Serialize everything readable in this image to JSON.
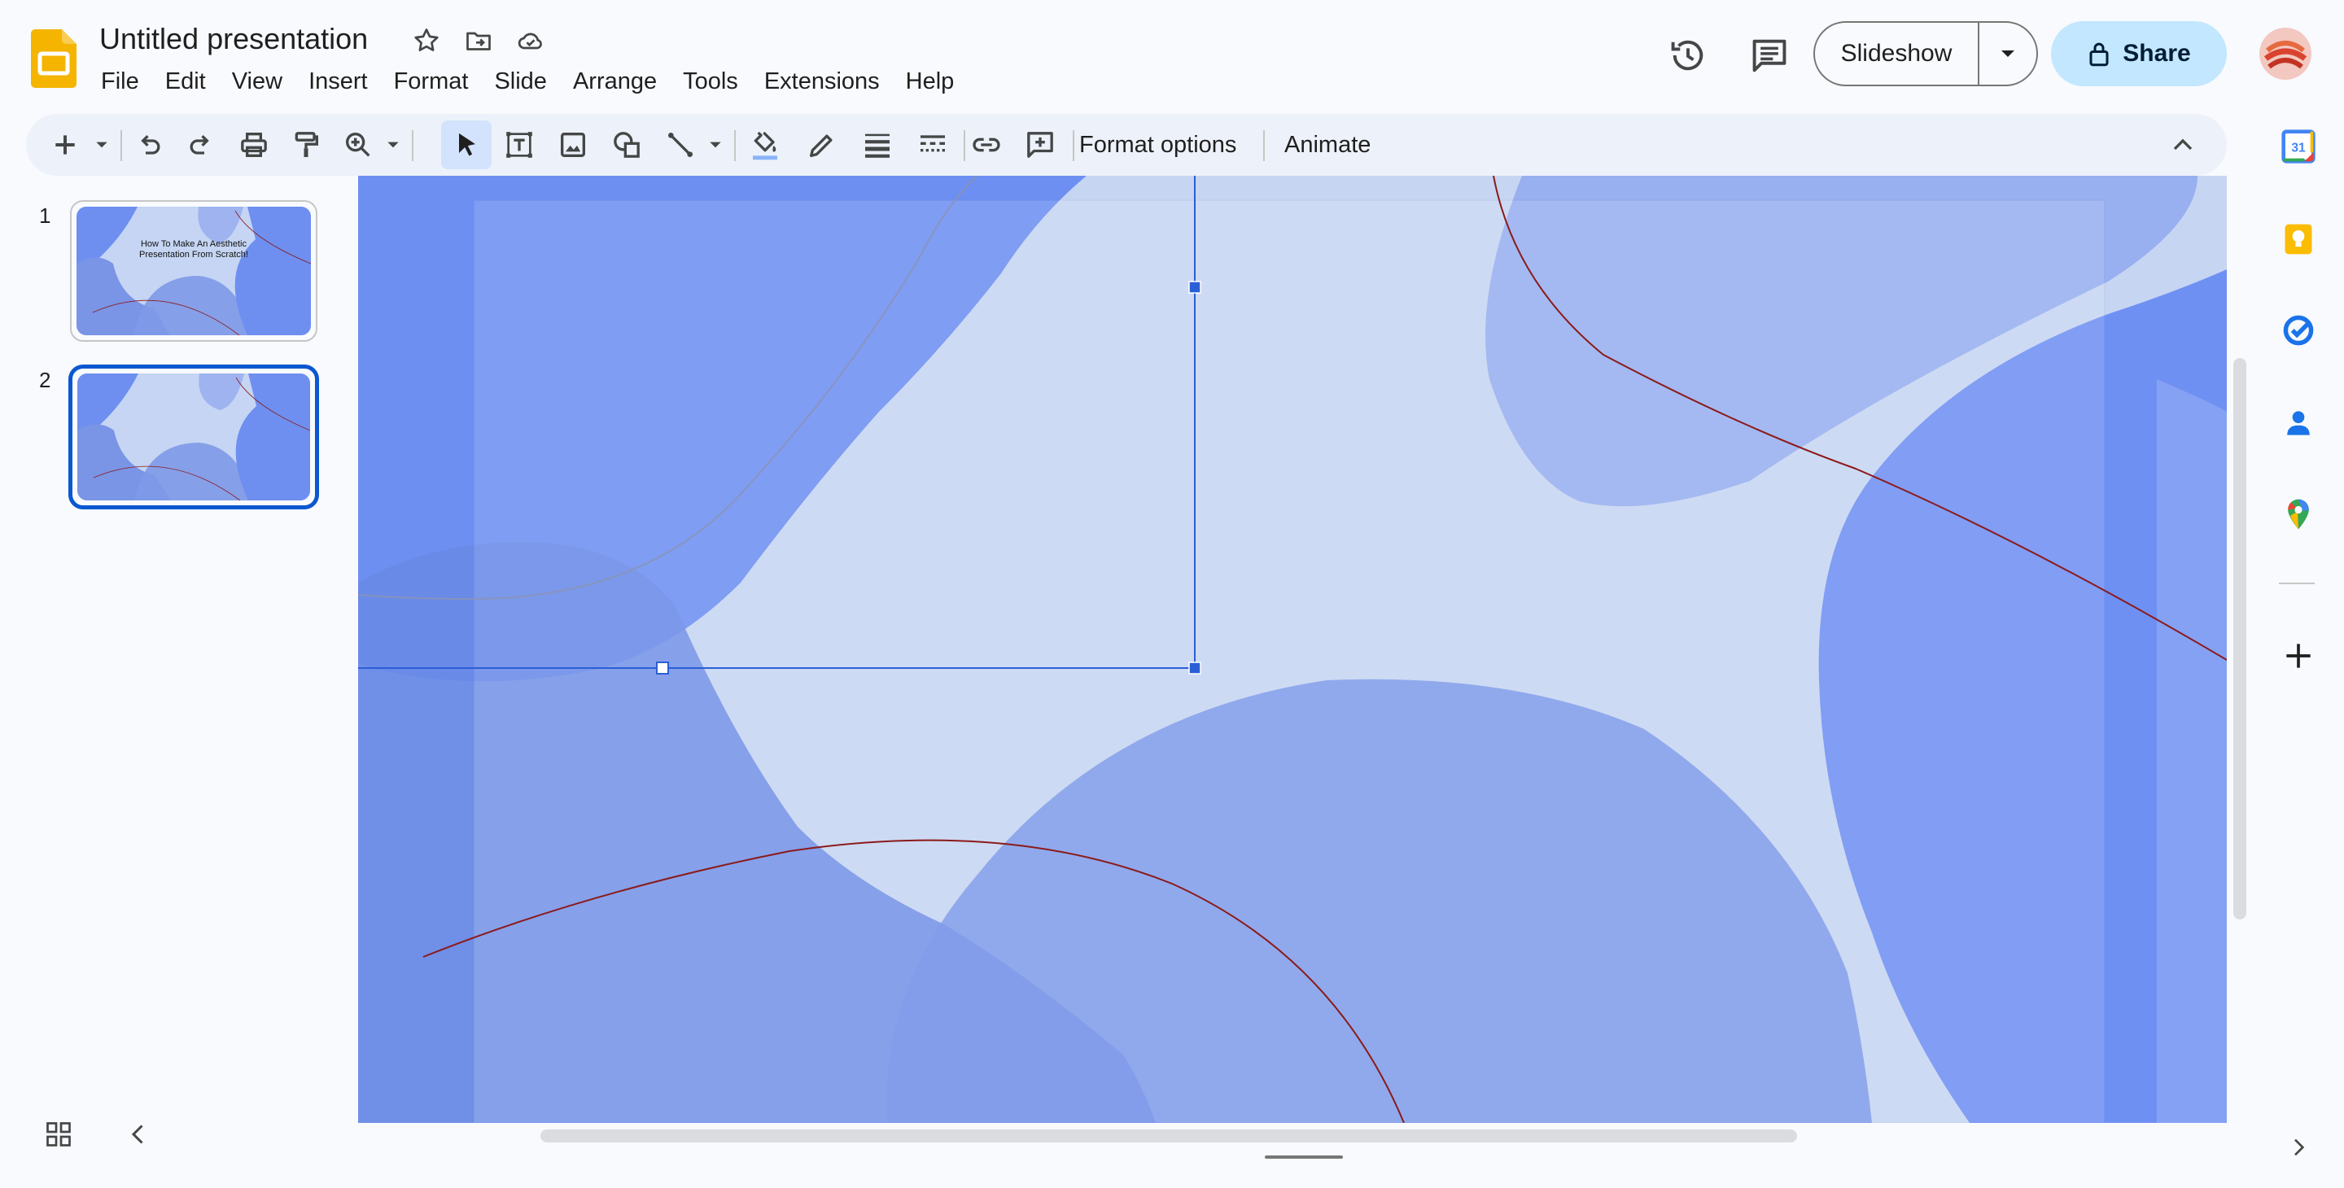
{
  "app": {
    "title": "Untitled presentation",
    "menu": [
      "File",
      "Edit",
      "View",
      "Insert",
      "Format",
      "Slide",
      "Arrange",
      "Tools",
      "Extensions",
      "Help"
    ]
  },
  "header": {
    "slideshow_label": "Slideshow",
    "share_label": "Share",
    "icons": [
      "star-icon",
      "move-to-folder-icon",
      "cloud-saved-icon",
      "version-history-icon",
      "comments-icon"
    ]
  },
  "toolbar": {
    "format_options": "Format options",
    "animate": "Animate",
    "icons": [
      "new-slide-icon",
      "undo-icon",
      "redo-icon",
      "print-icon",
      "paint-format-icon",
      "zoom-icon",
      "select-icon",
      "text-box-icon",
      "image-icon",
      "shape-icon",
      "line-icon",
      "fill-color-icon",
      "border-color-icon",
      "border-weight-icon",
      "border-dash-icon",
      "link-icon",
      "add-comment-icon",
      "collapse-icon"
    ]
  },
  "filmstrip": {
    "slides": [
      {
        "number": "1",
        "title_line1": "How To Make An Aesthetic",
        "title_line2": "Presentation From Scratch!"
      },
      {
        "number": "2"
      }
    ]
  },
  "side_panel": {
    "icons": [
      "calendar-icon",
      "keep-icon",
      "tasks-icon",
      "contacts-icon",
      "maps-icon",
      "add-icon"
    ],
    "calendar_day": "31"
  },
  "colors": {
    "accent": "#0b57d0",
    "share_bg": "#c2e7ff",
    "toolbar_bg": "#edf2fa",
    "slide_bg": "#c5d5f3",
    "blob_blue": "#5b7ef0",
    "curve_red": "#8b1a1a"
  }
}
